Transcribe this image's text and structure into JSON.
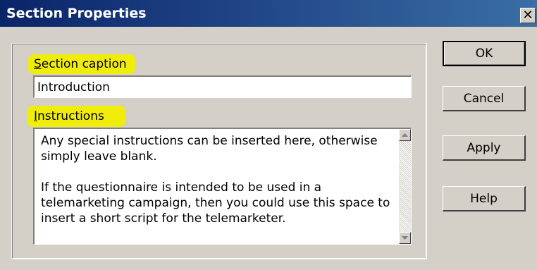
{
  "window": {
    "title": "Section Properties",
    "close_glyph": "✕"
  },
  "section_caption": {
    "label_mnemonic": "S",
    "label_rest": "ection caption",
    "value": "Introduction"
  },
  "instructions": {
    "label_mnemonic": "I",
    "label_rest": "nstructions",
    "paragraph1": "Any special instructions can be inserted here, otherwise simply leave blank.",
    "paragraph2": "If the questionnaire is intended to be used in a telemarketing campaign, then you could use this space to insert a short script for the telemarketer."
  },
  "buttons": {
    "ok": "OK",
    "cancel": "Cancel",
    "apply": "Apply",
    "help": "Help"
  },
  "colors": {
    "titlebar": "#0a246a",
    "highlight": "#f2ee00",
    "face": "#d4d0c8"
  },
  "icons": {
    "close": "close-icon",
    "scroll_up": "scroll-up-arrow-icon",
    "scroll_down": "scroll-down-arrow-icon"
  }
}
